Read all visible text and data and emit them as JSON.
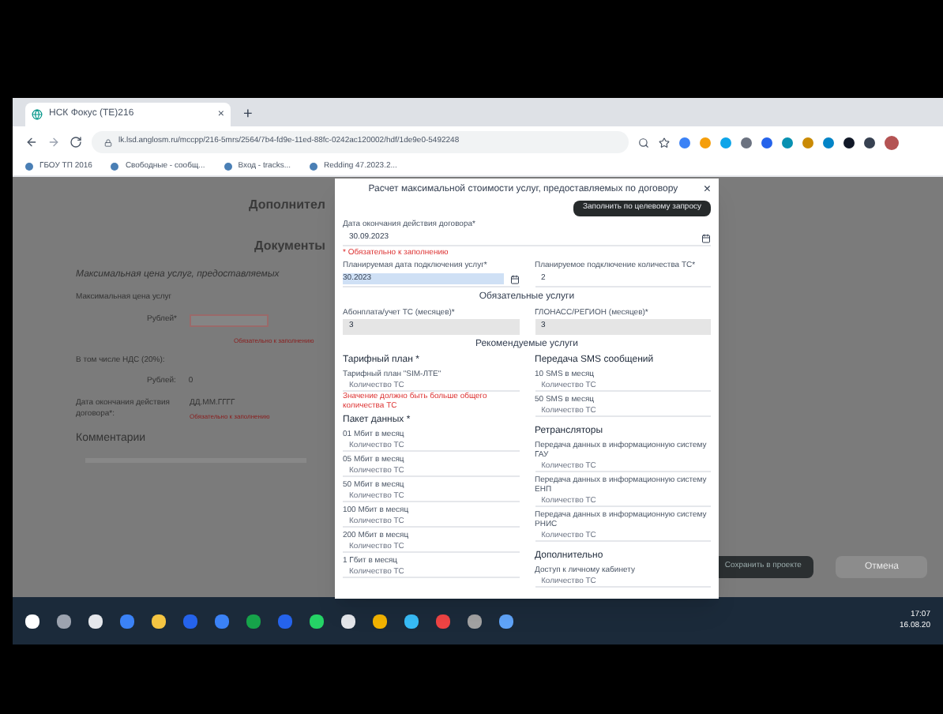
{
  "browser": {
    "tab": {
      "title": "НСК Фокус (ТЕ)216",
      "close": "×"
    },
    "new_tab": "+",
    "url": "lk.lsd.anglosm.ru/mccpp/216-5mrs/2564/7b4-fd9e-11ed-88fc-0242ac120002/hdf/1de9e0-5492248",
    "bookmarks": [
      {
        "label": "ГБОУ ТП 2016"
      },
      {
        "label": "Свободные - сообщ..."
      },
      {
        "label": "Вход - tracks..."
      },
      {
        "label": "Redding 47.2023.2..."
      }
    ]
  },
  "page": {
    "section_1": "Дополнител",
    "section_2": "Документы",
    "heading": "Максимальная цена услуг, предоставляемых",
    "price_label": "Максимальная цена услуг",
    "price_unit": "Рублей*",
    "price_error": "Обязательно к заполнению",
    "vat_label": "В том числе НДС (20%):",
    "vat_unit": "Рублей:",
    "vat_value": "0",
    "date_label": "Дата окончания действия договора*:",
    "date_placeholder": "ДД.ММ.ГГГГ",
    "date_error": "Обязательно к заполнению",
    "comments": "Комментарии",
    "save_button": "Сохранить в проекте",
    "cancel_button": "Отмена"
  },
  "modal": {
    "title": "Расчет максимальной стоимости услуг, предоставляемых по договору",
    "close": "×",
    "fill_button": "Заполнить по целевому запросу",
    "end_date": {
      "label": "Дата окончания действия договора*",
      "value": "30.09.2023"
    },
    "note": "* Обязательно к заполнению",
    "start_date": {
      "label": "Планируемая дата подключения услуг*",
      "value": "30.2023"
    },
    "vehicles": {
      "label": "Планируемое подключение количества ТС*",
      "value": "2"
    },
    "required_heading": "Обязательные услуги",
    "required_fields": [
      {
        "label": "Абонплата/учет ТС (месяцев)*",
        "value": "3"
      },
      {
        "label": "ГЛОНАСС/РЕГИОН (месяцев)*",
        "value": "3"
      }
    ],
    "optional_heading": "Рекомендуемые услуги",
    "left_groups": [
      {
        "heading": "Тарифный план *",
        "fields": [
          {
            "label": "Тарифный план \"SIM-ЛТЕ\"",
            "placeholder": "Количество ТС",
            "error": "Значение должно быть больше общего количества ТС"
          }
        ]
      },
      {
        "heading": "Пакет данных *",
        "fields": [
          {
            "label": "01 Мбит в месяц",
            "placeholder": "Количество ТС"
          },
          {
            "label": "05 Мбит в месяц",
            "placeholder": "Количество ТС"
          },
          {
            "label": "50 Мбит в месяц",
            "placeholder": "Количество ТС"
          },
          {
            "label": "100 Мбит в месяц",
            "placeholder": "Количество ТС"
          },
          {
            "label": "200 Мбит в месяц",
            "placeholder": "Количество ТС"
          },
          {
            "label": "1 Гбит в месяц",
            "placeholder": "Количество ТС"
          }
        ]
      }
    ],
    "right_groups": [
      {
        "heading": "Передача SMS сообщений",
        "fields": [
          {
            "label": "10 SMS в месяц",
            "placeholder": "Количество ТС"
          },
          {
            "label": "50 SMS в месяц",
            "placeholder": "Количество ТС"
          }
        ]
      },
      {
        "heading": "Ретрансляторы",
        "fields": [
          {
            "label": "Передача данных в информационную систему ГАУ",
            "placeholder": "Количество ТС"
          },
          {
            "label": "Передача данных в информационную систему ЕНП",
            "placeholder": "Количество ТС"
          },
          {
            "label": "Передача данных в информационную систему РНИС",
            "placeholder": "Количество ТС"
          }
        ]
      },
      {
        "heading": "Дополнительно",
        "fields": [
          {
            "label": "Доступ к личному кабинету",
            "placeholder": "Количество ТС"
          }
        ]
      }
    ]
  },
  "taskbar": {
    "time": "17:07",
    "date": "16.08.20"
  }
}
